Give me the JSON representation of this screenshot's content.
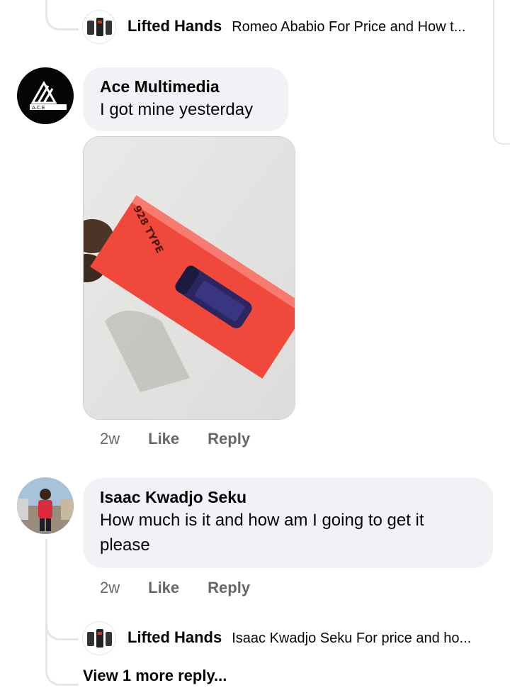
{
  "top_reply": {
    "name": "Lifted Hands",
    "snippet": "Romeo Ababio  For Price and How t..."
  },
  "comment1": {
    "author": "Ace Multimedia",
    "text": "I got mine yesterday",
    "avatar_text": "A.C.E",
    "photo_label": "928 TYPE",
    "time": "2w",
    "like": "Like",
    "reply": "Reply"
  },
  "comment2": {
    "author": "Isaac Kwadjo Seku",
    "text": "How much is it and how am I going to get it please",
    "time": "2w",
    "like": "Like",
    "reply": "Reply"
  },
  "bottom_reply": {
    "name": "Lifted Hands",
    "snippet": "Isaac Kwadjo Seku For price and ho..."
  },
  "view_more": "View 1 more reply...",
  "colors": {
    "bubble": "#f0f2f5",
    "meta": "#65676b",
    "thread": "#e4e6eb"
  }
}
